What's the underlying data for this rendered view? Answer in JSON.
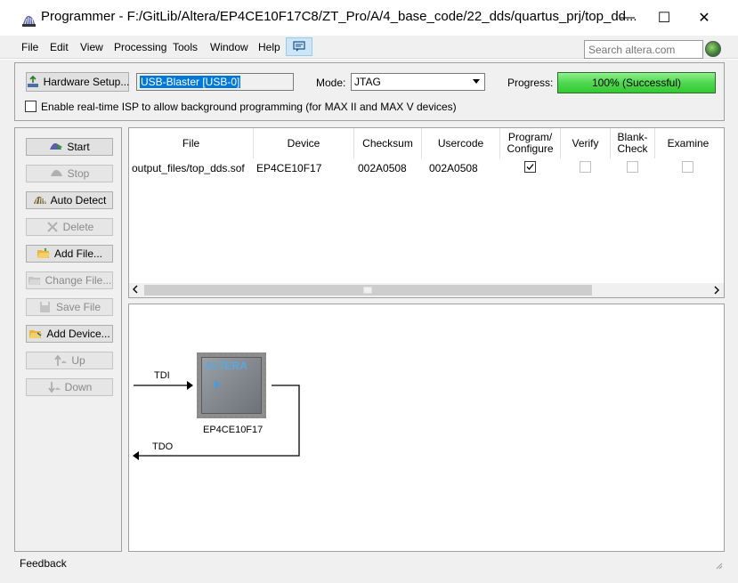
{
  "window": {
    "title": "Programmer - F:/GitLib/Altera/EP4CE10F17C8/ZT_Pro/A/4_base_code/22_dds/quartus_prj/top_dd...",
    "minimize": "—",
    "maximize": "☐",
    "close": "✕"
  },
  "menu": {
    "items": [
      "File",
      "Edit",
      "View",
      "Processing",
      "Tools",
      "Window",
      "Help"
    ],
    "search_placeholder": "Search altera.com"
  },
  "toolbar": {
    "hardware_setup_label": "Hardware Setup...",
    "hardware_value": "USB-Blaster [USB-0]",
    "mode_label": "Mode:",
    "mode_value": "JTAG",
    "progress_label": "Progress:",
    "progress_text": "100% (Successful)",
    "progress_fraction": 1.0,
    "isp_label": "Enable real-time ISP to allow background programming (for MAX II and MAX V devices)"
  },
  "actions": {
    "start": "Start",
    "stop": "Stop",
    "auto_detect": "Auto Detect",
    "delete": "Delete",
    "add_file": "Add File...",
    "change_file": "Change File...",
    "save_file": "Save File",
    "add_device": "Add Device...",
    "up": "Up",
    "down": "Down"
  },
  "table": {
    "headers": {
      "file": "File",
      "device": "Device",
      "checksum": "Checksum",
      "usercode": "Usercode",
      "program": "Program/ Configure",
      "verify": "Verify",
      "blank": "Blank- Check",
      "examine": "Examine"
    },
    "rows": [
      {
        "file": "output_files/top_dds.sof",
        "device": "EP4CE10F17",
        "checksum": "002A0508",
        "usercode": "002A0508",
        "program": true,
        "verify": false,
        "blank": false,
        "examine": false
      }
    ]
  },
  "diagram": {
    "tdi": "TDI",
    "tdo": "TDO",
    "chip_logo": "ALTERA",
    "chip_name": "EP4CE10F17"
  },
  "status": {
    "feedback": "Feedback"
  },
  "colors": {
    "progress_green": "#4fd84f",
    "selection_blue": "#0078d7"
  }
}
